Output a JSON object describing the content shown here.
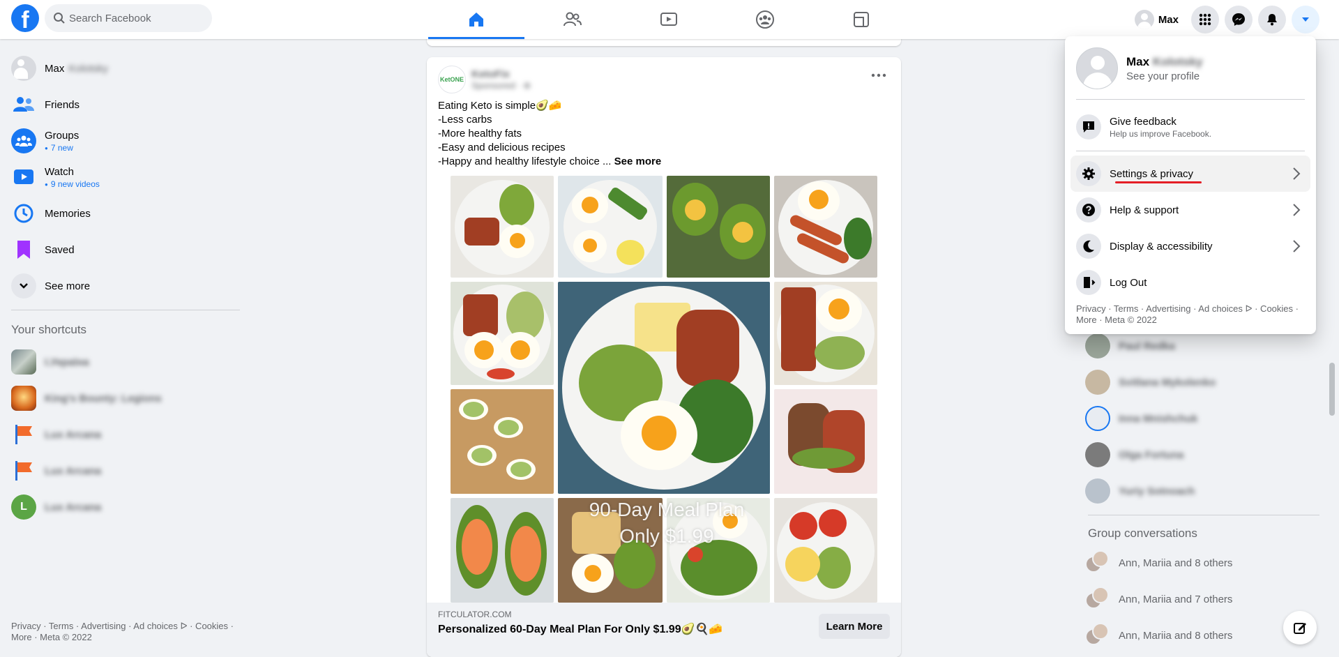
{
  "topbar": {
    "logo_letter": "f",
    "search_placeholder": "Search Facebook",
    "tabs": [
      "home-tab",
      "friends-tab",
      "watch-tab",
      "groups-tab",
      "gaming-tab"
    ],
    "user_short": "Max"
  },
  "leftnav": {
    "profile_name": "Max",
    "profile_surname": "Kolotsky",
    "items": [
      {
        "label": "Friends"
      },
      {
        "label": "Groups",
        "sub": "7 new"
      },
      {
        "label": "Watch",
        "sub": "9 new videos"
      },
      {
        "label": "Memories"
      },
      {
        "label": "Saved"
      },
      {
        "label": "See more"
      }
    ],
    "shortcuts_title": "Your shortcuts",
    "shortcuts": [
      "I.Україна",
      "King's Bounty: Legions",
      "Lux Arcana",
      "Lux Arcana",
      "Lux Arcana"
    ],
    "footer": "Privacy · Terms · Advertising · Ad choices ᐅ · Cookies · More · Meta © 2022"
  },
  "post": {
    "page_logo_text": "KetONE",
    "page_name": "KetoFix",
    "sponsored": "Sponsored · ⊛",
    "text": "Eating Keto is simple🥑🧀\n-Less carbs\n-More healthy fats\n-Easy and delicious recipes\n-Happy and healthy lifestyle choice ... ",
    "see_more": "See more",
    "overlay_line1": "90-Day Meal Plan",
    "overlay_line2": "Only $1.99",
    "link_domain": "FITCULATOR.COM",
    "link_title": "Personalized 60-Day Meal Plan For Only $1.99🥑🍳🧀",
    "cta": "Learn More"
  },
  "contacts": {
    "people": [
      "Paul Redka",
      "Svitlana Mykolenko",
      "Inna Mnishchuk",
      "Olga Fortuna",
      "Yuriy Sotnoach"
    ],
    "group_title": "Group conversations",
    "groups": [
      "Ann, Mariia and 8 others",
      "Ann, Mariia and 7 others",
      "Ann, Mariia and 8 others"
    ]
  },
  "menu": {
    "name": "Max",
    "surname": "Kolotsky",
    "see_profile": "See your profile",
    "feedback_title": "Give feedback",
    "feedback_sub": "Help us improve Facebook.",
    "items": [
      "Settings & privacy",
      "Help & support",
      "Display & accessibility",
      "Log Out"
    ],
    "footer": "Privacy · Terms · Advertising · Ad choices ᐅ · Cookies · More · Meta © 2022"
  },
  "colors": {
    "brand": "#1877f2",
    "highlight_underline": "#e41e26"
  }
}
